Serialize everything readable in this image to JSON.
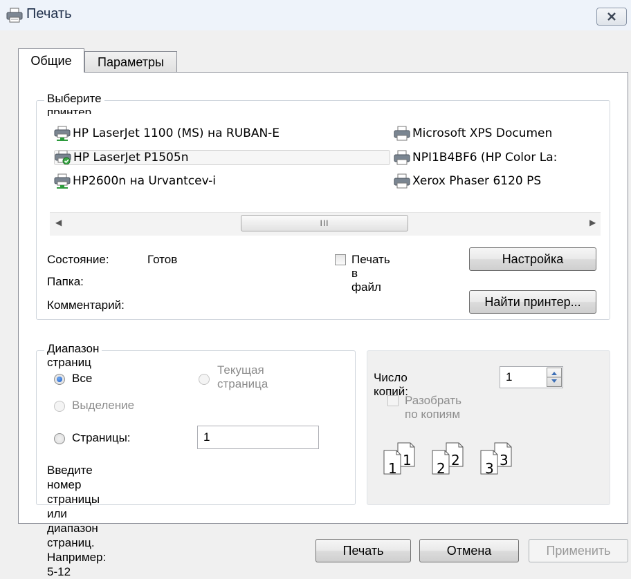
{
  "window": {
    "title": "Печать",
    "close_icon": "close-icon"
  },
  "tabs": [
    {
      "label": "Общие",
      "active": true
    },
    {
      "label": "Параметры",
      "active": false
    }
  ],
  "printer_group": {
    "legend": "Выберите принтер",
    "printers": [
      {
        "name": "HP LaserJet 1100 (MS) на RUBAN-E",
        "icon": "network-printer-icon"
      },
      {
        "name": "HP LaserJet P1505n",
        "icon": "default-printer-icon",
        "selected": true
      },
      {
        "name": "HP2600n на Urvantcev-i",
        "icon": "network-printer-icon"
      },
      {
        "name": "Microsoft XPS Documen",
        "icon": "printer-icon"
      },
      {
        "name": "NPI1B4BF6 (HP Color La:",
        "icon": "printer-icon"
      },
      {
        "name": "Xerox Phaser 6120 PS",
        "icon": "printer-icon"
      }
    ],
    "scrollbar_thumb_glyph": "III",
    "status_label": "Состояние:",
    "status_value": "Готов",
    "folder_label": "Папка:",
    "comment_label": "Комментарий:",
    "print_to_file_label": "Печать в файл",
    "setup_button": "Настройка",
    "find_printer_button": "Найти принтер..."
  },
  "range_group": {
    "legend": "Диапазон страниц",
    "all_label": "Все",
    "current_label_line1": "Текущая",
    "current_label_line2": "страница",
    "selection_label": "Выделение",
    "pages_label": "Страницы:",
    "pages_value": "1",
    "hint_line1": "Введите номер страницы или диапазон",
    "hint_line2": "страниц.  Например: 5-12"
  },
  "copies_group": {
    "copies_label": "Число копий:",
    "copies_value": "1",
    "collate_label": "Разобрать по копиям",
    "collate_pages": [
      "1",
      "1",
      "2",
      "2",
      "3",
      "3"
    ]
  },
  "footer": {
    "print_button": "Печать",
    "cancel_button": "Отмена",
    "apply_button": "Применить"
  }
}
